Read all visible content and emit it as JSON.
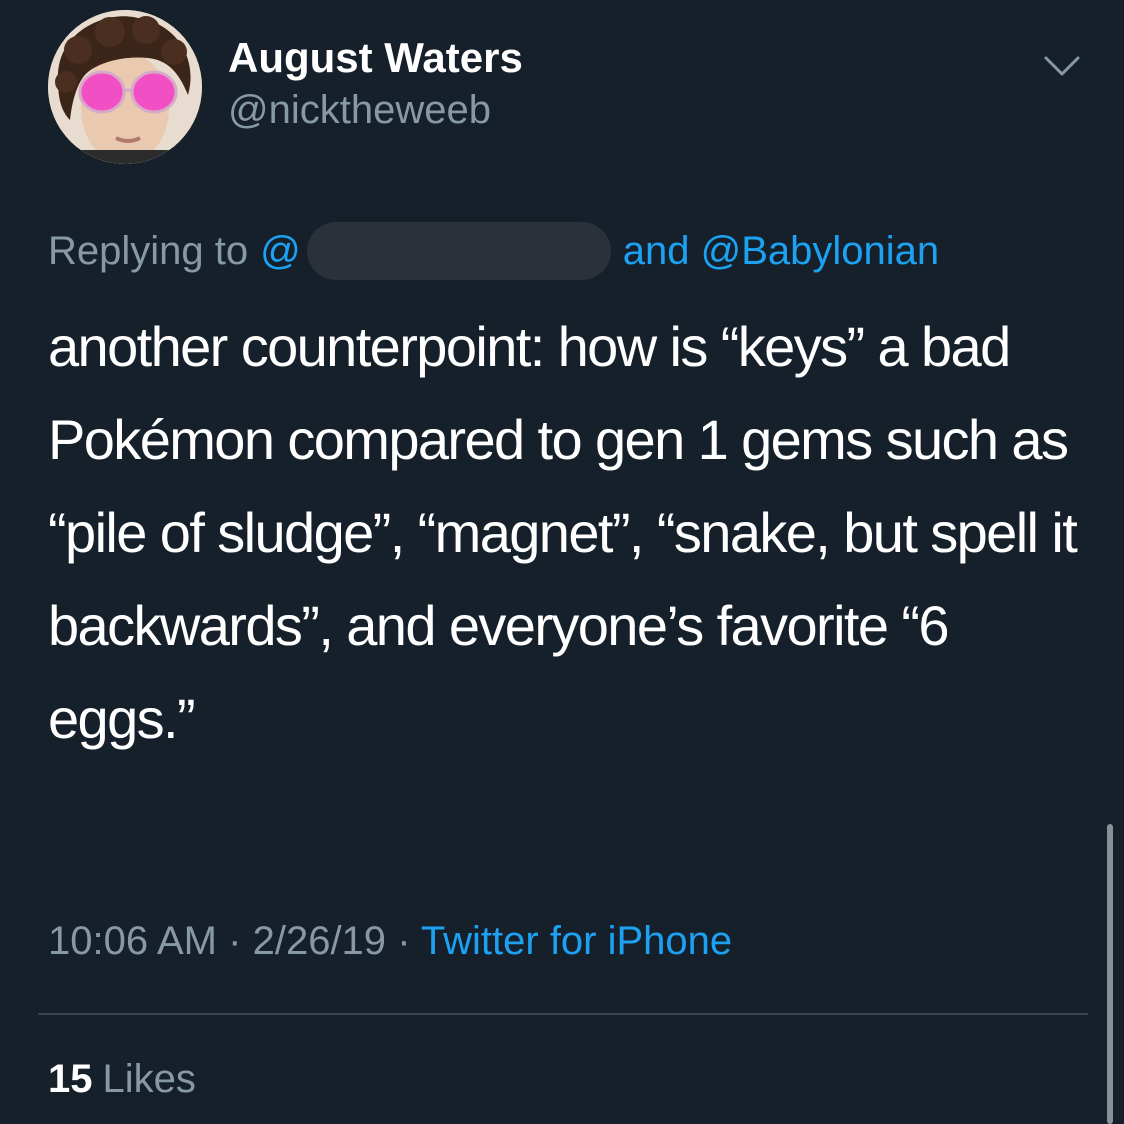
{
  "tweet": {
    "author": {
      "display_name": "August Waters",
      "handle": "@nicktheweeb"
    },
    "reply": {
      "prefix": "Replying to",
      "at": "@",
      "others": "and @Babylonian"
    },
    "text": "another counterpoint: how is “keys” a bad Pokémon compared to gen 1 gems such as “pile of sludge”, “magnet”, “snake, but spell it backwards”, and everyone’s favorite “6 eggs.”",
    "time": "10:06 AM",
    "separator": "·",
    "date": "2/26/19",
    "source": "Twitter for iPhone",
    "likes": {
      "count": "15",
      "label": "Likes"
    }
  },
  "icons": {
    "menu": "chevron-down-icon"
  },
  "colors": {
    "background": "#15202b",
    "primary_text": "#ffffff",
    "muted_text": "#8899a6",
    "accent": "#1da1f2",
    "divider": "#38444d"
  }
}
